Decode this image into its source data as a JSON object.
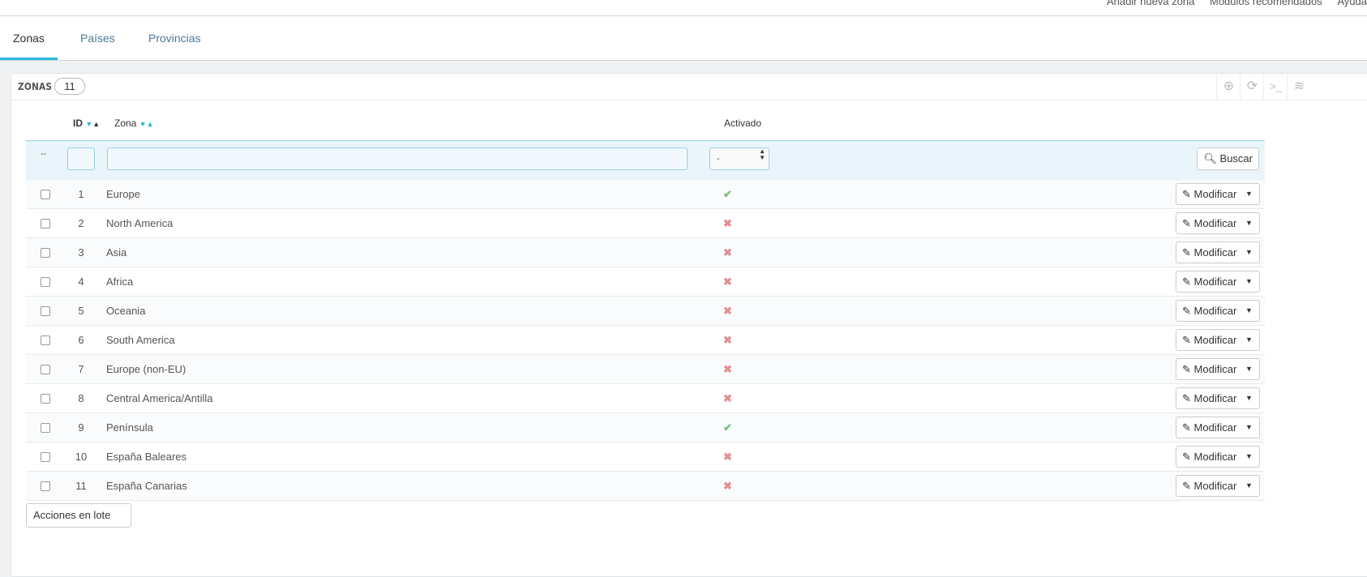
{
  "toolbar": {
    "add_zone": "Añadir nueva zona",
    "recommended_modules": "Módulos recomendados",
    "help": "Ayuda"
  },
  "tabs": [
    {
      "label": "Zonas",
      "active": true
    },
    {
      "label": "Países",
      "active": false
    },
    {
      "label": "Provincias",
      "active": false
    }
  ],
  "panel": {
    "title": "ZONAS",
    "count": "11",
    "tools": [
      "add-circle-icon",
      "refresh-icon",
      "terminal-icon",
      "database-icon"
    ]
  },
  "table": {
    "columns": {
      "id": "ID",
      "zone": "Zona",
      "enabled": "Activado"
    },
    "filters": {
      "bulk_placeholder": "--",
      "enabled_select": "-",
      "search_button": "Buscar"
    },
    "rows": [
      {
        "id": "1",
        "zone": "Europe",
        "enabled": true
      },
      {
        "id": "2",
        "zone": "North America",
        "enabled": false
      },
      {
        "id": "3",
        "zone": "Asia",
        "enabled": false
      },
      {
        "id": "4",
        "zone": "Africa",
        "enabled": false
      },
      {
        "id": "5",
        "zone": "Oceania",
        "enabled": false
      },
      {
        "id": "6",
        "zone": "South America",
        "enabled": false
      },
      {
        "id": "7",
        "zone": "Europe (non-EU)",
        "enabled": false
      },
      {
        "id": "8",
        "zone": "Central America/Antilla",
        "enabled": false
      },
      {
        "id": "9",
        "zone": "Península",
        "enabled": true
      },
      {
        "id": "10",
        "zone": "España Baleares",
        "enabled": false
      },
      {
        "id": "11",
        "zone": "España Canarias",
        "enabled": false
      }
    ],
    "row_action": "Modificar"
  },
  "bulk_actions": {
    "label": "Acciones en lote"
  },
  "colors": {
    "accent": "#25b9d7",
    "enabled": "#72c279",
    "disabled": "#e08f95",
    "filter_bg": "#e9f5fa"
  }
}
